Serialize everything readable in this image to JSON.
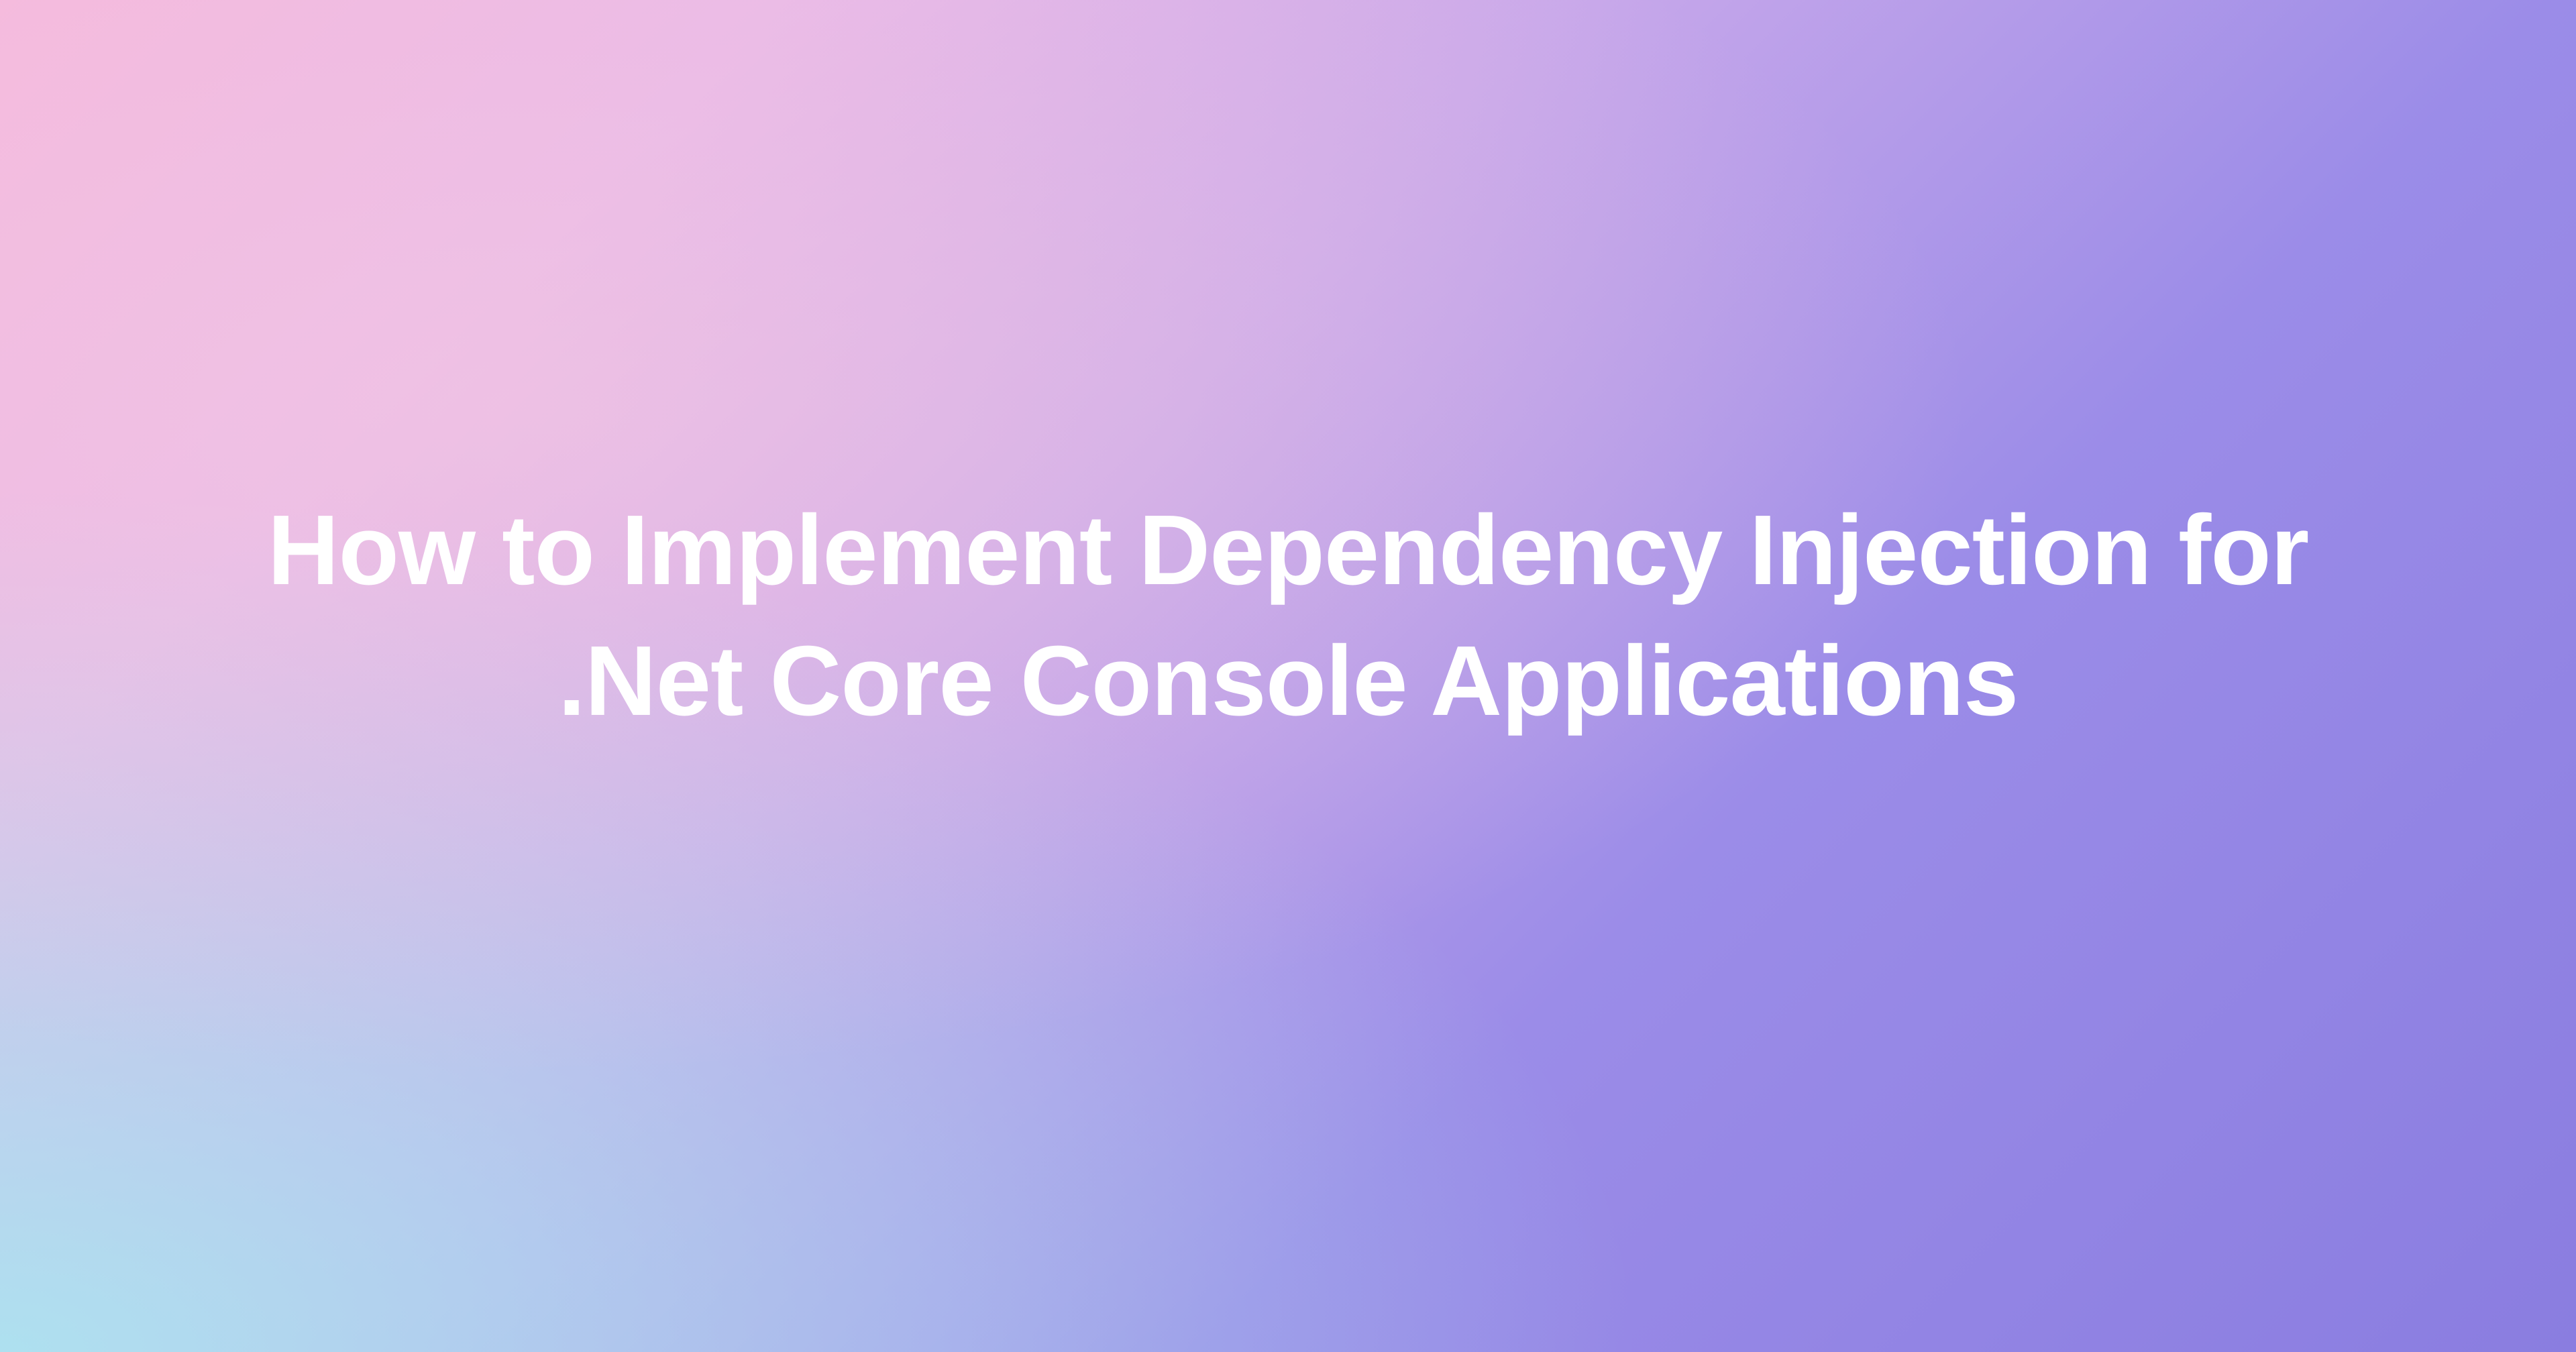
{
  "hero": {
    "title": "How to Implement Dependency Injection for .Net Core Console Applications"
  }
}
